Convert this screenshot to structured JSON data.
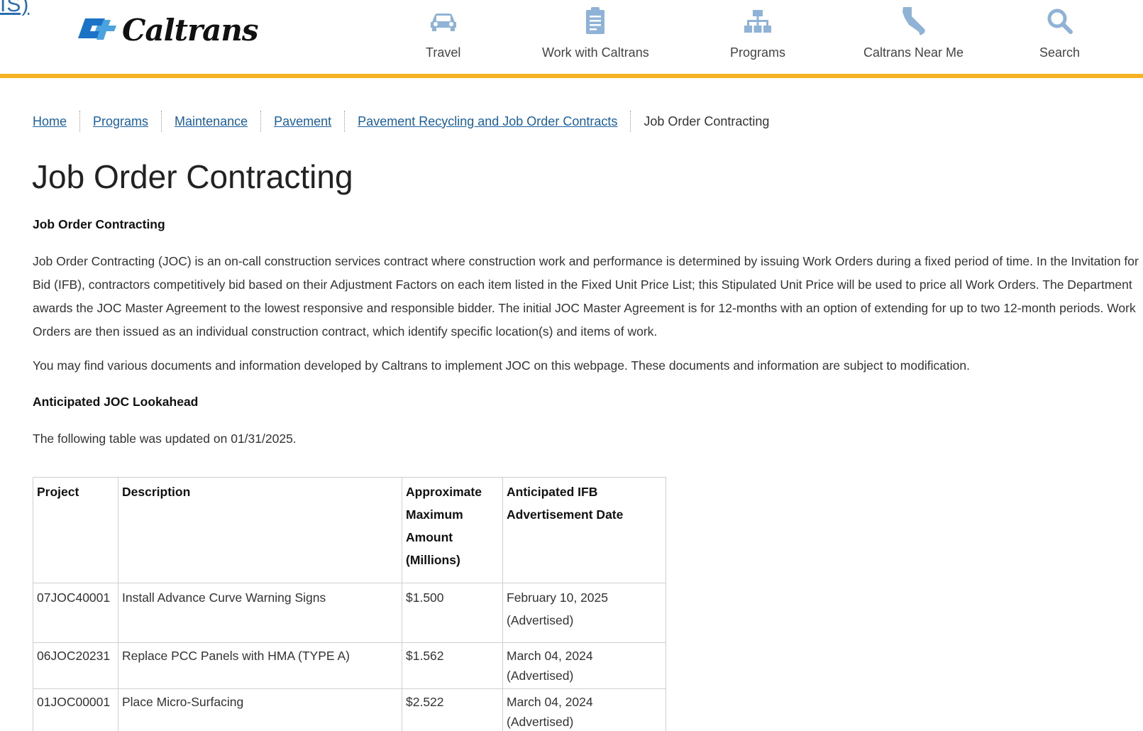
{
  "page": {
    "title": "Job Order Contracting"
  },
  "skip_fragment": "IS)",
  "header": {
    "logo_alt": "Caltrans",
    "logo_text": "Caltrans",
    "nav": [
      {
        "label": "Travel",
        "icon": "car-icon"
      },
      {
        "label": "Work with Caltrans",
        "icon": "clipboard-icon"
      },
      {
        "label": "Programs",
        "icon": "sitemap-icon"
      },
      {
        "label": "Caltrans Near Me",
        "icon": "california-map-icon"
      },
      {
        "label": "Search",
        "icon": "search-icon"
      }
    ],
    "accent_color": "#f5b324",
    "icon_color": "#8fb3d6"
  },
  "breadcrumb": [
    {
      "label": "Home"
    },
    {
      "label": "Programs"
    },
    {
      "label": "Maintenance"
    },
    {
      "label": "Pavement"
    },
    {
      "label": "Pavement Recycling and Job Order Contracts"
    },
    {
      "label": "Job Order Contracting"
    }
  ],
  "main": {
    "section_heading": "Job Order Contracting",
    "intro": "Job Order Contracting (JOC) is an on-call construction services contract where construction work and performance is determined by issuing Work Orders during a fixed period of time.  In the Invitation for Bid (IFB), contractors competitively bid based on their Adjustment Factors on each item listed in the Fixed Unit Price List; this Stipulated Unit Price will be used to price all Work Orders.  The Department awards the JOC Master Agreement to the lowest responsive and responsible bidder.  The initial JOC Master Agreement is for 12-months with an option of extending for up to two 12-month periods.  Work Orders are then issued as an individual construction contract, which identify specific location(s) and items of work.",
    "docs_note": "You may find various documents and information developed by Caltrans to implement JOC on this webpage. These documents and information are subject to modification.",
    "lookahead_heading": "Anticipated JOC Lookahead",
    "updated_note": "The following table was updated on 01/31/2025.",
    "table": {
      "headers": [
        "Project",
        "Description",
        "Approximate Maximum Amount (Millions)",
        "Anticipated IFB Advertisement Date"
      ],
      "rows": [
        [
          "07JOC40001",
          "Install Advance Curve Warning Signs",
          "$1.500",
          "February 10, 2025 (Advertised)"
        ],
        [
          "06JOC20231",
          "Replace PCC Panels with HMA (TYPE A)",
          "$1.562",
          "March 04, 2024 (Advertised)"
        ],
        [
          "01JOC00001",
          "Place Micro-Surfacing",
          "$2.522",
          "March 04, 2024 (Advertised)"
        ]
      ]
    }
  }
}
